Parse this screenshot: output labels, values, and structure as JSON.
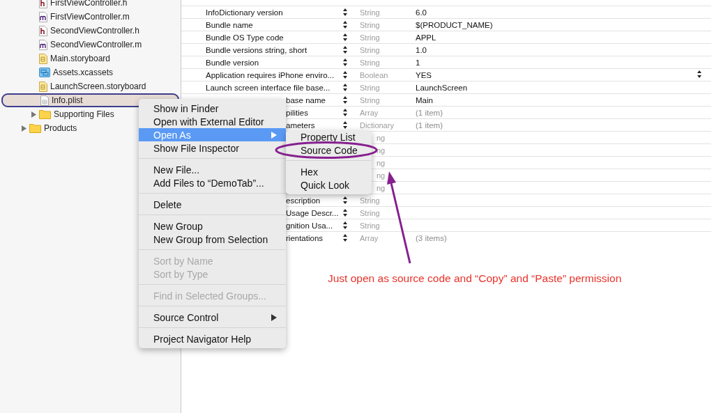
{
  "sidebar": {
    "items": [
      {
        "children": [
          {
            "name": "FirstViewController.h",
            "kind": "header",
            "selected": false
          },
          {
            "name": "FirstViewController.m",
            "kind": "source",
            "selected": false
          },
          {
            "name": "SecondViewController.h",
            "kind": "header",
            "selected": false
          },
          {
            "name": "SecondViewController.m",
            "kind": "source",
            "selected": false
          },
          {
            "name": "Main.storyboard",
            "kind": "storyboard",
            "selected": false
          },
          {
            "name": "Assets.xcassets",
            "kind": "assets",
            "selected": false
          },
          {
            "name": "LaunchScreen.storyboard",
            "kind": "storyboard",
            "selected": false
          },
          {
            "name": "Info.plist",
            "kind": "plist",
            "selected": true
          },
          {
            "name": "Supporting Files",
            "kind": "folder",
            "expanded": false,
            "selected": false
          }
        ]
      },
      {
        "name": "Products",
        "kind": "folder",
        "expanded": false,
        "selected": false
      }
    ]
  },
  "plist": {
    "rows": [
      {
        "key": "InfoDictionary version",
        "type": "String",
        "value": "6.0",
        "collection": false,
        "popup": false
      },
      {
        "key": "Bundle name",
        "type": "String",
        "value": "$(PRODUCT_NAME)",
        "collection": false,
        "popup": false
      },
      {
        "key": "Bundle OS Type code",
        "type": "String",
        "value": "APPL",
        "collection": false,
        "popup": false
      },
      {
        "key": "Bundle versions string, short",
        "type": "String",
        "value": "1.0",
        "collection": false,
        "popup": false
      },
      {
        "key": "Bundle version",
        "type": "String",
        "value": "1",
        "collection": false,
        "popup": false
      },
      {
        "key": "Application requires iPhone enviro...",
        "type": "Boolean",
        "value": "YES",
        "collection": false,
        "popup": true
      },
      {
        "key": "Launch screen interface file base...",
        "type": "String",
        "value": "LaunchScreen",
        "collection": false,
        "popup": false
      },
      {
        "key": "base name",
        "key_covered": true,
        "type": "String",
        "value": "Main",
        "collection": false,
        "popup": false
      },
      {
        "key": "pilities",
        "key_covered": true,
        "type": "Array",
        "value": "(1 item)",
        "collection": true,
        "popup": false
      },
      {
        "key": "ameters",
        "key_covered": true,
        "type": "Dictionary",
        "value": "(1 item)",
        "collection": true,
        "popup": false
      },
      {
        "type": "ng",
        "type_covered": true,
        "popup": false
      },
      {
        "type": "ng",
        "type_covered": true,
        "popup": false
      },
      {
        "type": "ng",
        "type_covered": true,
        "popup": false
      },
      {
        "type": "ng",
        "type_covered": true,
        "popup": false
      },
      {
        "type": "ng",
        "type_covered": true,
        "popup": false
      },
      {
        "key": "escription",
        "key_covered": true,
        "type": "String",
        "popup": false
      },
      {
        "key": "Usage Descr...",
        "key_covered": true,
        "type": "String",
        "popup": false
      },
      {
        "key": "gnition Usa...",
        "key_covered": true,
        "type": "String",
        "popup": false
      },
      {
        "key": "rientations",
        "key_covered": true,
        "type": "Array",
        "value": "(3 items)",
        "collection": true,
        "popup": false
      }
    ]
  },
  "context_menu": {
    "items": [
      {
        "kind": "item",
        "label": "Show in Finder",
        "selected": false,
        "disabled": false,
        "has_submenu": false
      },
      {
        "kind": "item",
        "label": "Open with External Editor",
        "selected": false,
        "disabled": false,
        "has_submenu": false
      },
      {
        "kind": "item",
        "label": "Open As",
        "selected": true,
        "disabled": false,
        "has_submenu": true
      },
      {
        "kind": "item",
        "label": "Show File Inspector",
        "selected": false,
        "disabled": false,
        "has_submenu": false
      },
      {
        "kind": "separator"
      },
      {
        "kind": "item",
        "label": "New File...",
        "selected": false,
        "disabled": false,
        "has_submenu": false
      },
      {
        "kind": "item",
        "label": "Add Files to “DemoTab”...",
        "selected": false,
        "disabled": false,
        "has_submenu": false
      },
      {
        "kind": "separator"
      },
      {
        "kind": "item",
        "label": "Delete",
        "selected": false,
        "disabled": false,
        "has_submenu": false
      },
      {
        "kind": "separator"
      },
      {
        "kind": "item",
        "label": "New Group",
        "selected": false,
        "disabled": false,
        "has_submenu": false
      },
      {
        "kind": "item",
        "label": "New Group from Selection",
        "selected": false,
        "disabled": false,
        "has_submenu": false
      },
      {
        "kind": "separator"
      },
      {
        "kind": "item",
        "label": "Sort by Name",
        "selected": false,
        "disabled": true,
        "has_submenu": false
      },
      {
        "kind": "item",
        "label": "Sort by Type",
        "selected": false,
        "disabled": true,
        "has_submenu": false
      },
      {
        "kind": "separator"
      },
      {
        "kind": "item",
        "label": "Find in Selected Groups...",
        "selected": false,
        "disabled": true,
        "has_submenu": false
      },
      {
        "kind": "separator"
      },
      {
        "kind": "item",
        "label": "Source Control",
        "selected": false,
        "disabled": false,
        "has_submenu": true
      },
      {
        "kind": "separator"
      },
      {
        "kind": "item",
        "label": "Project Navigator Help",
        "selected": false,
        "disabled": false,
        "has_submenu": false
      }
    ]
  },
  "submenu": {
    "items": [
      {
        "kind": "item",
        "label": "Property List"
      },
      {
        "kind": "item",
        "label": "Source Code"
      },
      {
        "kind": "separator"
      },
      {
        "kind": "item",
        "label": "Hex"
      },
      {
        "kind": "item",
        "label": "Quick Look"
      }
    ]
  },
  "annotation": {
    "text": "Just open as source code and “Copy” and “Paste” permission"
  }
}
